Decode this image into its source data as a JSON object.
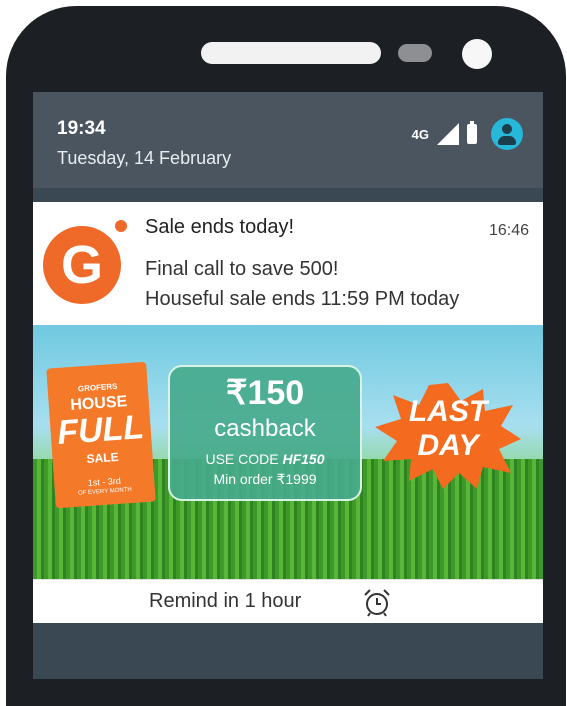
{
  "status_bar": {
    "time": "19:34",
    "date": "Tuesday, 14 February",
    "network": "4G",
    "icons": [
      "signal-icon",
      "battery-icon",
      "account-icon"
    ],
    "account_color": "#27b7d8"
  },
  "notification": {
    "app_icon_letter": "G",
    "app_color": "#ef6a28",
    "title": "Sale ends today!",
    "time": "16:46",
    "line1": "Final call to save 500!",
    "line2": "Houseful sale ends 11:59 PM today",
    "banner": {
      "bag": {
        "brand": "GROFERS",
        "house": "HOUSE",
        "full": "FULL",
        "sale": "SALE",
        "dates": "1st - 3rd",
        "sub": "OF EVERY MONTH"
      },
      "cashback": {
        "amount": "₹150",
        "word": "cashback",
        "code_prefix": "USE CODE ",
        "code": "HF150",
        "min_order": "Min order ₹1999"
      },
      "burst": {
        "line1": "LAST",
        "line2": "DAY"
      }
    },
    "action": {
      "label": "Remind in 1 hour",
      "icon": "alarm-clock-icon"
    }
  }
}
